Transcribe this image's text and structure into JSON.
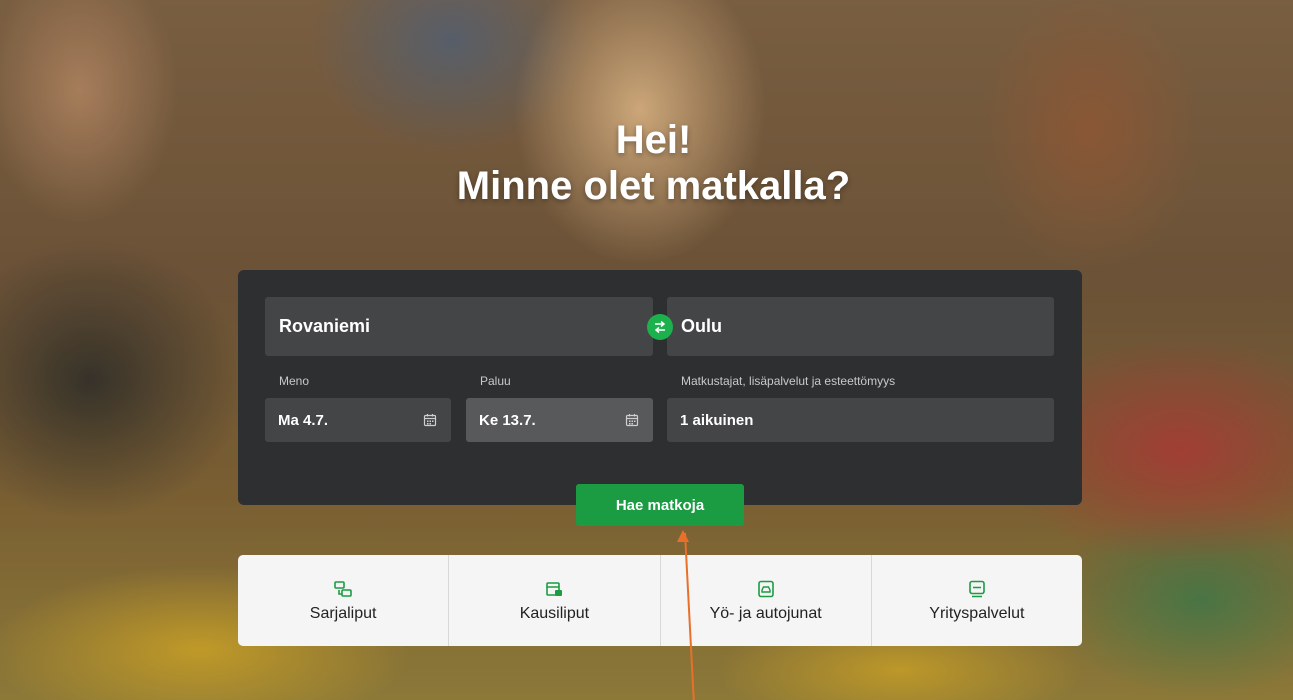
{
  "hero": {
    "greeting_line1": "Hei!",
    "greeting_line2": "Minne olet matkalla?"
  },
  "search": {
    "from": "Rovaniemi",
    "to": "Oulu",
    "departure_label": "Meno",
    "departure_value": "Ma 4.7.",
    "return_label": "Paluu",
    "return_value": "Ke 13.7.",
    "passengers_label": "Matkustajat, lisäpalvelut ja esteettömyys",
    "passengers_value": "1 aikuinen",
    "search_button": "Hae matkoja",
    "accent_color": "#1db14e"
  },
  "quick_links": [
    {
      "label": "Sarjaliput",
      "icon": "series-ticket-icon"
    },
    {
      "label": "Kausiliput",
      "icon": "season-ticket-icon"
    },
    {
      "label": "Yö- ja autojunat",
      "icon": "car-train-icon"
    },
    {
      "label": "Yrityspalvelut",
      "icon": "business-services-icon"
    }
  ]
}
